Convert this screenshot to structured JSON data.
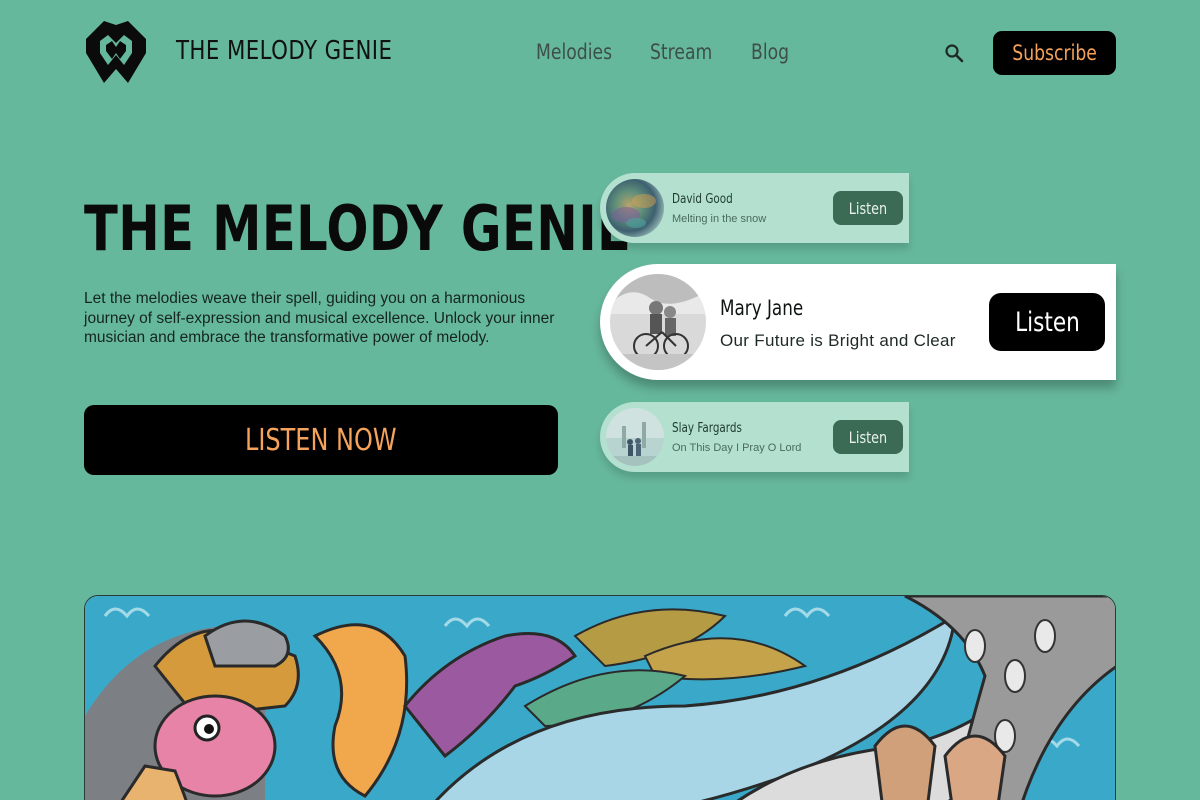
{
  "header": {
    "brand": "THE MELODY GENIE",
    "nav": [
      "Melodies",
      "Stream",
      "Blog"
    ],
    "subscribe_label": "Subscribe"
  },
  "hero": {
    "title": "THE MELODY GENIE",
    "description": "Let the melodies weave their spell, guiding you on a harmonious journey of self-expression and musical excellence. Unlock your inner musician and embrace the transformative power of melody.",
    "cta_label": "LISTEN NOW"
  },
  "tracks": [
    {
      "artist": "David Good",
      "song": "Melting in the snow",
      "button": "Listen"
    },
    {
      "artist": "Mary Jane",
      "song": "Our Future is Bright and Clear",
      "button": "Listen"
    },
    {
      "artist": "Slay Fargards",
      "song": "On This Day I Pray O Lord",
      "button": "Listen"
    }
  ],
  "colors": {
    "background": "#66b89d",
    "accent": "#f5a25a",
    "button_dark": "#000000",
    "card_small": "#b3e0cf",
    "card_button": "#3c6b55"
  },
  "icons": {
    "logo": "melody-genie-logo-icon",
    "search": "search-icon"
  }
}
